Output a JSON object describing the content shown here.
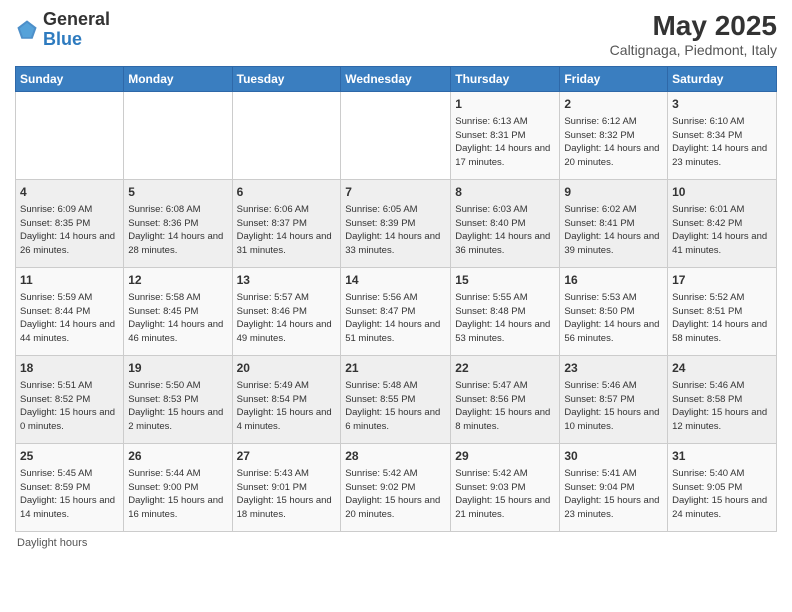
{
  "header": {
    "logo_general": "General",
    "logo_blue": "Blue",
    "month_title": "May 2025",
    "location": "Caltignaga, Piedmont, Italy"
  },
  "days_of_week": [
    "Sunday",
    "Monday",
    "Tuesday",
    "Wednesday",
    "Thursday",
    "Friday",
    "Saturday"
  ],
  "weeks": [
    [
      {
        "day": "",
        "info": ""
      },
      {
        "day": "",
        "info": ""
      },
      {
        "day": "",
        "info": ""
      },
      {
        "day": "",
        "info": ""
      },
      {
        "day": "1",
        "info": "Sunrise: 6:13 AM\nSunset: 8:31 PM\nDaylight: 14 hours and 17 minutes."
      },
      {
        "day": "2",
        "info": "Sunrise: 6:12 AM\nSunset: 8:32 PM\nDaylight: 14 hours and 20 minutes."
      },
      {
        "day": "3",
        "info": "Sunrise: 6:10 AM\nSunset: 8:34 PM\nDaylight: 14 hours and 23 minutes."
      }
    ],
    [
      {
        "day": "4",
        "info": "Sunrise: 6:09 AM\nSunset: 8:35 PM\nDaylight: 14 hours and 26 minutes."
      },
      {
        "day": "5",
        "info": "Sunrise: 6:08 AM\nSunset: 8:36 PM\nDaylight: 14 hours and 28 minutes."
      },
      {
        "day": "6",
        "info": "Sunrise: 6:06 AM\nSunset: 8:37 PM\nDaylight: 14 hours and 31 minutes."
      },
      {
        "day": "7",
        "info": "Sunrise: 6:05 AM\nSunset: 8:39 PM\nDaylight: 14 hours and 33 minutes."
      },
      {
        "day": "8",
        "info": "Sunrise: 6:03 AM\nSunset: 8:40 PM\nDaylight: 14 hours and 36 minutes."
      },
      {
        "day": "9",
        "info": "Sunrise: 6:02 AM\nSunset: 8:41 PM\nDaylight: 14 hours and 39 minutes."
      },
      {
        "day": "10",
        "info": "Sunrise: 6:01 AM\nSunset: 8:42 PM\nDaylight: 14 hours and 41 minutes."
      }
    ],
    [
      {
        "day": "11",
        "info": "Sunrise: 5:59 AM\nSunset: 8:44 PM\nDaylight: 14 hours and 44 minutes."
      },
      {
        "day": "12",
        "info": "Sunrise: 5:58 AM\nSunset: 8:45 PM\nDaylight: 14 hours and 46 minutes."
      },
      {
        "day": "13",
        "info": "Sunrise: 5:57 AM\nSunset: 8:46 PM\nDaylight: 14 hours and 49 minutes."
      },
      {
        "day": "14",
        "info": "Sunrise: 5:56 AM\nSunset: 8:47 PM\nDaylight: 14 hours and 51 minutes."
      },
      {
        "day": "15",
        "info": "Sunrise: 5:55 AM\nSunset: 8:48 PM\nDaylight: 14 hours and 53 minutes."
      },
      {
        "day": "16",
        "info": "Sunrise: 5:53 AM\nSunset: 8:50 PM\nDaylight: 14 hours and 56 minutes."
      },
      {
        "day": "17",
        "info": "Sunrise: 5:52 AM\nSunset: 8:51 PM\nDaylight: 14 hours and 58 minutes."
      }
    ],
    [
      {
        "day": "18",
        "info": "Sunrise: 5:51 AM\nSunset: 8:52 PM\nDaylight: 15 hours and 0 minutes."
      },
      {
        "day": "19",
        "info": "Sunrise: 5:50 AM\nSunset: 8:53 PM\nDaylight: 15 hours and 2 minutes."
      },
      {
        "day": "20",
        "info": "Sunrise: 5:49 AM\nSunset: 8:54 PM\nDaylight: 15 hours and 4 minutes."
      },
      {
        "day": "21",
        "info": "Sunrise: 5:48 AM\nSunset: 8:55 PM\nDaylight: 15 hours and 6 minutes."
      },
      {
        "day": "22",
        "info": "Sunrise: 5:47 AM\nSunset: 8:56 PM\nDaylight: 15 hours and 8 minutes."
      },
      {
        "day": "23",
        "info": "Sunrise: 5:46 AM\nSunset: 8:57 PM\nDaylight: 15 hours and 10 minutes."
      },
      {
        "day": "24",
        "info": "Sunrise: 5:46 AM\nSunset: 8:58 PM\nDaylight: 15 hours and 12 minutes."
      }
    ],
    [
      {
        "day": "25",
        "info": "Sunrise: 5:45 AM\nSunset: 8:59 PM\nDaylight: 15 hours and 14 minutes."
      },
      {
        "day": "26",
        "info": "Sunrise: 5:44 AM\nSunset: 9:00 PM\nDaylight: 15 hours and 16 minutes."
      },
      {
        "day": "27",
        "info": "Sunrise: 5:43 AM\nSunset: 9:01 PM\nDaylight: 15 hours and 18 minutes."
      },
      {
        "day": "28",
        "info": "Sunrise: 5:42 AM\nSunset: 9:02 PM\nDaylight: 15 hours and 20 minutes."
      },
      {
        "day": "29",
        "info": "Sunrise: 5:42 AM\nSunset: 9:03 PM\nDaylight: 15 hours and 21 minutes."
      },
      {
        "day": "30",
        "info": "Sunrise: 5:41 AM\nSunset: 9:04 PM\nDaylight: 15 hours and 23 minutes."
      },
      {
        "day": "31",
        "info": "Sunrise: 5:40 AM\nSunset: 9:05 PM\nDaylight: 15 hours and 24 minutes."
      }
    ]
  ],
  "footer": {
    "note": "Daylight hours"
  }
}
